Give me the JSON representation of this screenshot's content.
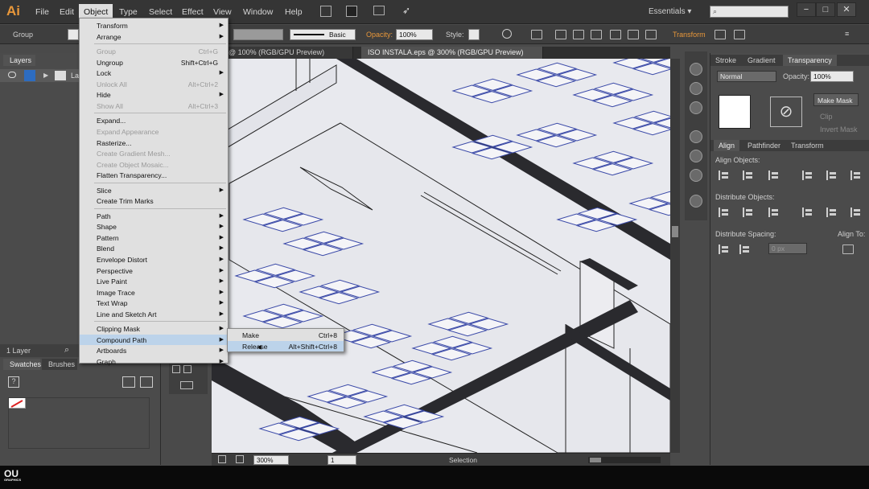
{
  "app": {
    "logo": "Ai",
    "workspace": "Essentials ▾"
  },
  "menubar": [
    "File",
    "Edit",
    "Object",
    "Type",
    "Select",
    "Effect",
    "View",
    "Window",
    "Help"
  ],
  "control": {
    "selection": "Group",
    "stroke_profile": "Basic",
    "opacity_label": "Opacity:",
    "opacity_value": "100%",
    "style_label": "Style:",
    "transform": "Transform"
  },
  "documents": {
    "tab1": "al* @ 100% (RGB/GPU Preview)",
    "tab2": "ISO INSTALA.eps @ 300% (RGB/GPU Preview)"
  },
  "object_menu": [
    {
      "label": "Transform",
      "shortcut": "",
      "submenu": true,
      "enabled": true
    },
    {
      "label": "Arrange",
      "shortcut": "",
      "submenu": true,
      "enabled": true
    },
    {
      "sep": true
    },
    {
      "label": "Group",
      "shortcut": "Ctrl+G",
      "submenu": false,
      "enabled": false
    },
    {
      "label": "Ungroup",
      "shortcut": "Shift+Ctrl+G",
      "submenu": false,
      "enabled": true
    },
    {
      "label": "Lock",
      "shortcut": "",
      "submenu": true,
      "enabled": true
    },
    {
      "label": "Unlock All",
      "shortcut": "Alt+Ctrl+2",
      "submenu": false,
      "enabled": false
    },
    {
      "label": "Hide",
      "shortcut": "",
      "submenu": true,
      "enabled": true
    },
    {
      "label": "Show All",
      "shortcut": "Alt+Ctrl+3",
      "submenu": false,
      "enabled": false
    },
    {
      "sep": true
    },
    {
      "label": "Expand...",
      "shortcut": "",
      "submenu": false,
      "enabled": true
    },
    {
      "label": "Expand Appearance",
      "shortcut": "",
      "submenu": false,
      "enabled": false
    },
    {
      "label": "Rasterize...",
      "shortcut": "",
      "submenu": false,
      "enabled": true
    },
    {
      "label": "Create Gradient Mesh...",
      "shortcut": "",
      "submenu": false,
      "enabled": false
    },
    {
      "label": "Create Object Mosaic...",
      "shortcut": "",
      "submenu": false,
      "enabled": false
    },
    {
      "label": "Flatten Transparency...",
      "shortcut": "",
      "submenu": false,
      "enabled": true
    },
    {
      "sep": true
    },
    {
      "label": "Slice",
      "shortcut": "",
      "submenu": true,
      "enabled": true
    },
    {
      "label": "Create Trim Marks",
      "shortcut": "",
      "submenu": false,
      "enabled": true
    },
    {
      "sep": true
    },
    {
      "label": "Path",
      "shortcut": "",
      "submenu": true,
      "enabled": true
    },
    {
      "label": "Shape",
      "shortcut": "",
      "submenu": true,
      "enabled": true
    },
    {
      "label": "Pattern",
      "shortcut": "",
      "submenu": true,
      "enabled": true
    },
    {
      "label": "Blend",
      "shortcut": "",
      "submenu": true,
      "enabled": true
    },
    {
      "label": "Envelope Distort",
      "shortcut": "",
      "submenu": true,
      "enabled": true
    },
    {
      "label": "Perspective",
      "shortcut": "",
      "submenu": true,
      "enabled": true
    },
    {
      "label": "Live Paint",
      "shortcut": "",
      "submenu": true,
      "enabled": true
    },
    {
      "label": "Image Trace",
      "shortcut": "",
      "submenu": true,
      "enabled": true
    },
    {
      "label": "Text Wrap",
      "shortcut": "",
      "submenu": true,
      "enabled": true
    },
    {
      "label": "Line and Sketch Art",
      "shortcut": "",
      "submenu": true,
      "enabled": true
    },
    {
      "sep": true
    },
    {
      "label": "Clipping Mask",
      "shortcut": "",
      "submenu": true,
      "enabled": true
    },
    {
      "label": "Compound Path",
      "shortcut": "",
      "submenu": true,
      "enabled": true,
      "highlight": true
    },
    {
      "label": "Artboards",
      "shortcut": "",
      "submenu": true,
      "enabled": true
    },
    {
      "label": "Graph",
      "shortcut": "",
      "submenu": true,
      "enabled": true
    }
  ],
  "compound_submenu": [
    {
      "label": "Make",
      "shortcut": "Ctrl+8"
    },
    {
      "label": "Release",
      "shortcut": "Alt+Shift+Ctrl+8"
    }
  ],
  "layers": {
    "tab": "Layers",
    "row_label": "La",
    "count": "1 Layer"
  },
  "swatches": {
    "tab1": "Swatches",
    "tab2": "Brushes"
  },
  "transparency": {
    "tabs": [
      "Stroke",
      "Gradient",
      "Transparency"
    ],
    "mode": "Normal",
    "opacity_label": "Opacity:",
    "opacity": "100%",
    "make_mask": "Make Mask",
    "clip": "Clip",
    "invert": "Invert Mask"
  },
  "align": {
    "tabs": [
      "Align",
      "Pathfinder",
      "Transform"
    ],
    "align_objects": "Align Objects:",
    "distribute_objects": "Distribute Objects:",
    "distribute_spacing": "Distribute Spacing:",
    "align_to": "Align To:",
    "spacing": "0 px"
  },
  "status": {
    "zoom": "300%",
    "page": "1",
    "tool": "Selection"
  },
  "brand": {
    "line1": "OU",
    "line2": "GRAPHICS"
  }
}
